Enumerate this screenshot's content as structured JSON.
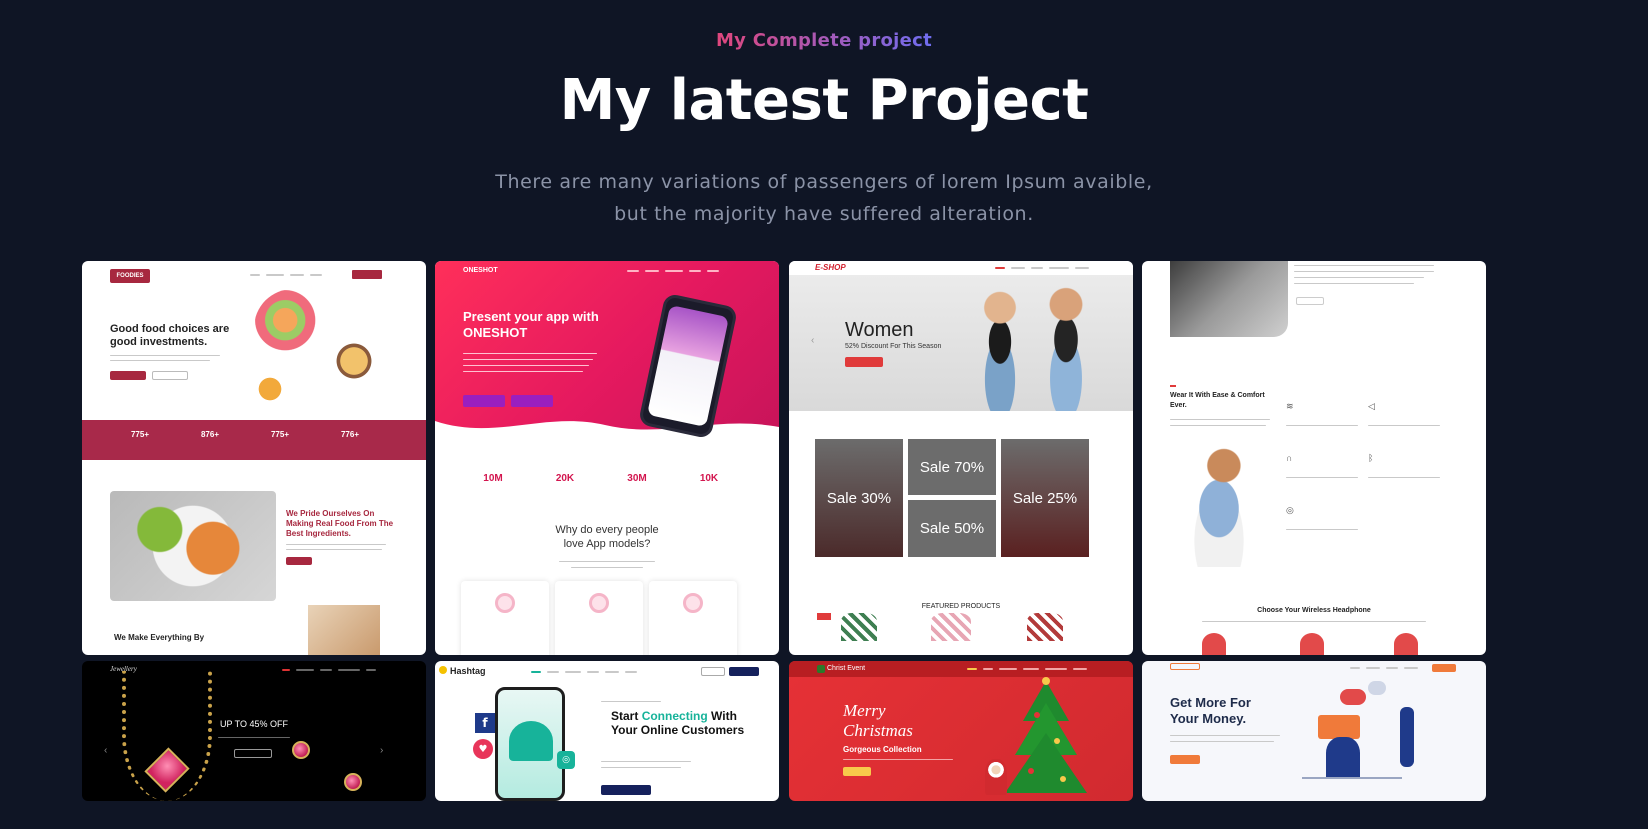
{
  "section": {
    "eyebrow": "My Complete project",
    "title": "My latest Project",
    "description_line1": "There are many variations of passengers of lorem Ipsum avaible,",
    "description_line2": "but the majority have suffered alteration."
  },
  "cards": [
    {
      "logo": "FOODIES",
      "headline": "Good food choices are good investments.",
      "stats": [
        "775+",
        "876+",
        "775+",
        "776+"
      ],
      "subheadline": "We Pride Ourselves On Making Real Food From The Best Ingredients.",
      "bottom_title": "We Make Everything By"
    },
    {
      "logo": "ONESHOT",
      "headline": "Present your app with ONESHOT",
      "stats": [
        "10M",
        "20K",
        "30M",
        "10K"
      ],
      "section_title": "Why do every people love App models?"
    },
    {
      "logo": "E-SHOP",
      "hero_title": "Women",
      "hero_subtitle": "52% Discount For This Season",
      "tiles": [
        "Sale 30%",
        "Sale 70%",
        "Sale 50%",
        "Sale 25%"
      ],
      "featured": "FEATURED PRODUCTS"
    },
    {
      "headline": "Wear It With Ease & Comfort Ever.",
      "footer_title": "Choose Your Wireless Headphone"
    },
    {
      "logo": "Jewellery",
      "headline": "UP TO 45% OFF"
    },
    {
      "logo": "Hashtag",
      "headline_start": "Start",
      "headline_accent": "Connecting",
      "headline_rest": "With Your Online Customers"
    },
    {
      "logo": "Christ Event",
      "headline": "Merry Christmas",
      "subheadline": "Gorgeous Collection"
    },
    {
      "headline": "Get More For Your Money."
    }
  ]
}
